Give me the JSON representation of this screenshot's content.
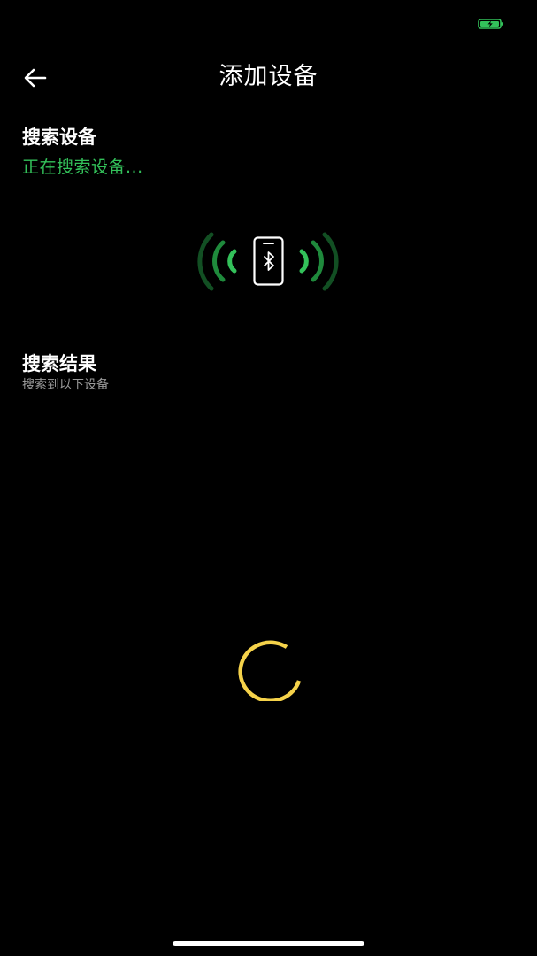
{
  "colors": {
    "background": "#000000",
    "accent_green": "#33c15a",
    "spinner_yellow": "#f5d24a",
    "muted_text": "#9a9a9a"
  },
  "status_bar": {
    "battery_icon": "battery-charging-icon"
  },
  "header": {
    "back_icon": "arrow-left-icon",
    "title": "添加设备"
  },
  "search": {
    "title": "搜索设备",
    "status": "正在搜索设备..."
  },
  "radar": {
    "icon": "bluetooth-phone-icon"
  },
  "results": {
    "title": "搜索结果",
    "subtitle": "搜索到以下设备"
  },
  "loading": {
    "icon": "loading-spinner-icon"
  }
}
